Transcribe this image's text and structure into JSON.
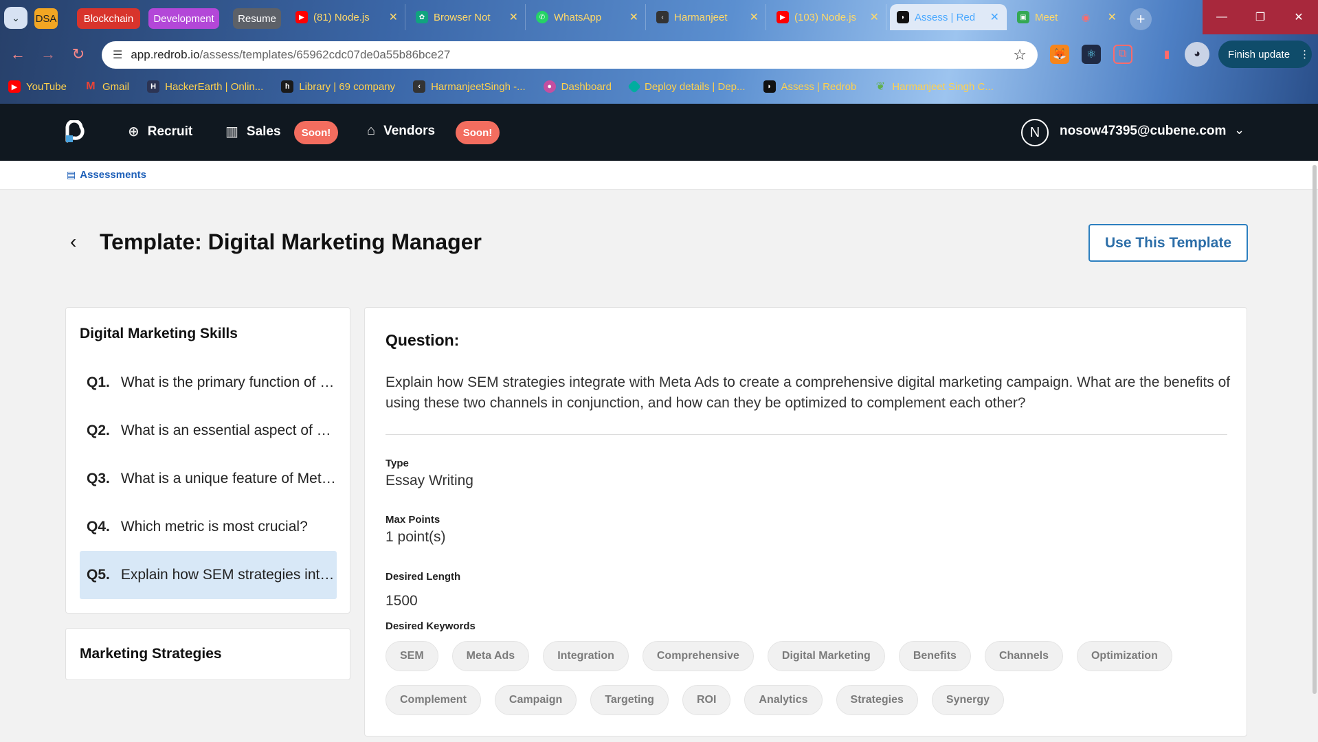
{
  "browser": {
    "tab_groups": [
      {
        "label": "DSA",
        "color": "#f2a623"
      },
      {
        "label": "Blockchain",
        "color": "#d8342c"
      },
      {
        "label": "Development",
        "color": "#b347d8"
      },
      {
        "label": "Resume",
        "color": "#5d6168"
      }
    ],
    "tabs": [
      {
        "label": "(81) Node.js",
        "favicon": "youtube-icon",
        "favcolor": "#ff0000"
      },
      {
        "label": "Browser Not",
        "favicon": "chatgpt-icon",
        "favcolor": "#10a37f"
      },
      {
        "label": "WhatsApp",
        "favicon": "whatsapp-icon",
        "favcolor": "#25d366"
      },
      {
        "label": "Harmanjeet",
        "favicon": "link-icon",
        "favcolor": "#333333"
      },
      {
        "label": "(103) Node.js",
        "favicon": "youtube-icon",
        "favcolor": "#ff0000"
      },
      {
        "label": "Assess | Red",
        "favicon": "redrob-icon",
        "favcolor": "#111111",
        "active": true
      },
      {
        "label": "Meet",
        "favicon": "meet-icon",
        "favcolor": "#34a853"
      }
    ],
    "url_host": "app.redrob.io",
    "url_path": "/assess/templates/65962cdc07de0a55b86bce27",
    "finish_update_label": "Finish update",
    "bookmarks": [
      {
        "label": "YouTube",
        "icon": "youtube-icon",
        "color": "#ff0000"
      },
      {
        "label": "Gmail",
        "icon": "gmail-icon",
        "color": "#ea4335"
      },
      {
        "label": "HackerEarth | Onlin...",
        "icon": "hackerearth-icon",
        "color": "#2c3454"
      },
      {
        "label": "Library | 69 company",
        "icon": "library-icon",
        "color": "#1a1a1a"
      },
      {
        "label": "HarmanjeetSingh -...",
        "icon": "link-icon",
        "color": "#333333"
      },
      {
        "label": "Dashboard",
        "icon": "dashboard-icon",
        "color": "#c44fa0"
      },
      {
        "label": "Deploy details | Dep...",
        "icon": "deploy-icon",
        "color": "#00ad9f"
      },
      {
        "label": "Assess | Redrob",
        "icon": "redrob-icon",
        "color": "#111111"
      },
      {
        "label": "Harmanjeet Singh C...",
        "icon": "leaf-icon",
        "color": "#5fb04b"
      }
    ]
  },
  "app": {
    "nav": {
      "recruit": "Recruit",
      "sales": "Sales",
      "vendors": "Vendors",
      "soon_badge": "Soon!"
    },
    "user": {
      "initial": "N",
      "email": "nosow47395@cubene.com"
    },
    "breadcrumb": "Assessments"
  },
  "page": {
    "title": "Template: Digital Marketing Manager",
    "use_template_label": "Use This Template"
  },
  "sections": [
    {
      "title": "Digital Marketing Skills",
      "questions": [
        {
          "num": "Q1.",
          "text": "What is the primary function of SEM?"
        },
        {
          "num": "Q2.",
          "text": "What is an essential aspect of Meta Ads?"
        },
        {
          "num": "Q3.",
          "text": "What is a unique feature of Meta Ads?"
        },
        {
          "num": "Q4.",
          "text": "Which metric is most crucial?"
        },
        {
          "num": "Q5.",
          "text": "Explain how SEM strategies integrate with Meta Ads",
          "selected": true
        }
      ]
    },
    {
      "title": "Marketing Strategies",
      "questions": []
    }
  ],
  "question_detail": {
    "heading": "Question:",
    "text": "Explain how SEM strategies integrate with Meta Ads to create a comprehensive digital marketing campaign. What are the benefits of using these two channels in conjunction, and how can they be optimized to complement each other?",
    "type_label": "Type",
    "type_value": "Essay Writing",
    "max_points_label": "Max Points",
    "max_points_value": "1 point(s)",
    "desired_length_label": "Desired Length",
    "desired_length_value": "1500",
    "keywords_label": "Desired Keywords",
    "keywords": [
      "SEM",
      "Meta Ads",
      "Integration",
      "Comprehensive",
      "Digital Marketing",
      "Benefits",
      "Channels",
      "Optimization",
      "Complement",
      "Campaign",
      "Targeting",
      "ROI",
      "Analytics",
      "Strategies",
      "Synergy"
    ]
  },
  "colors": {
    "appbar": "#101820",
    "soon_badge": "#f36d5f",
    "selected_question": "#d8e8f7",
    "link_blue": "#1d5fb8"
  }
}
